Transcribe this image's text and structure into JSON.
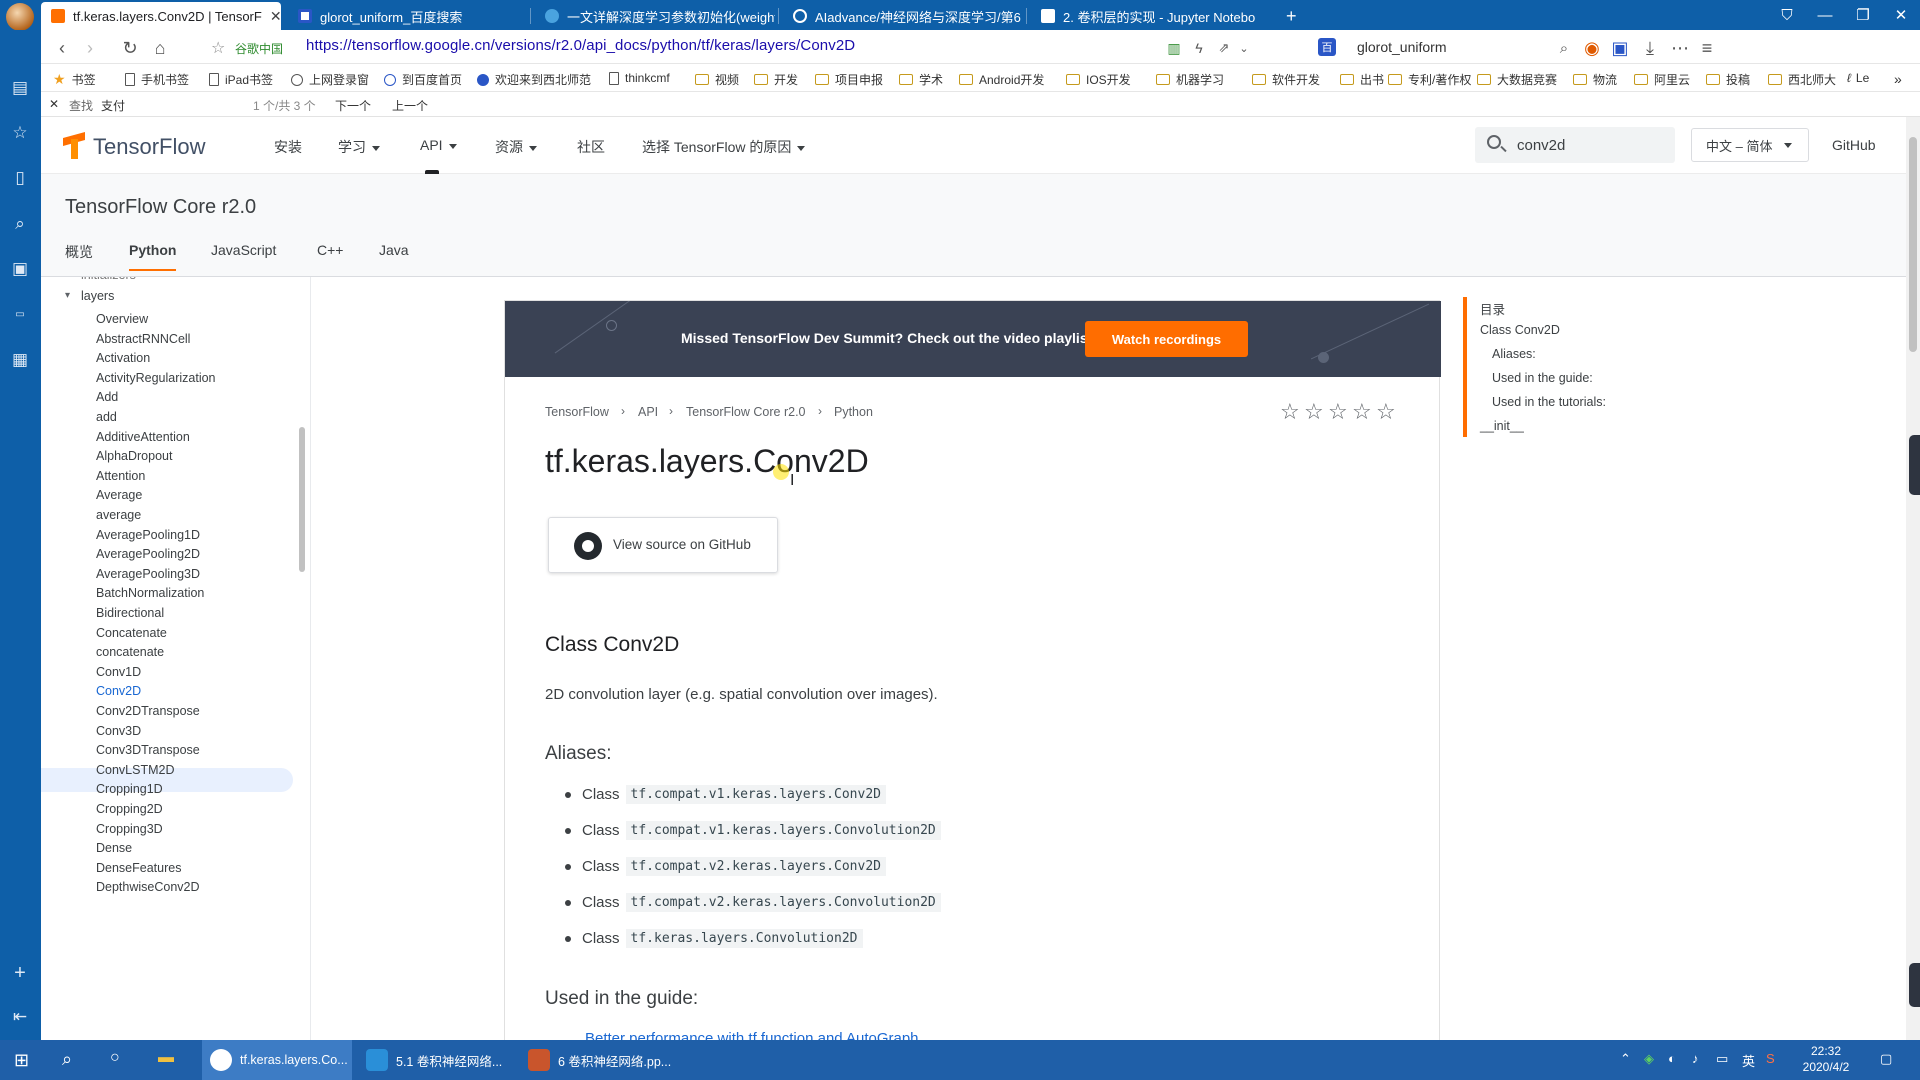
{
  "browser": {
    "tabs": [
      {
        "title": "tf.keras.layers.Conv2D  |  TensorF",
        "active": true
      },
      {
        "title": "glorot_uniform_百度搜索"
      },
      {
        "title": "一文详解深度学习参数初始化(weight"
      },
      {
        "title": "AIadvance/神经网络与深度学习/第6"
      },
      {
        "title": "2. 卷积层的实现 - Jupyter Notebo"
      }
    ],
    "new_tab": "+",
    "url_site": "谷歌中国",
    "url": "https://tensorflow.google.cn/versions/r2.0/api_docs/python/tf/keras/layers/Conv2D",
    "search_engine_value": "glorot_uniform"
  },
  "bookmarks": [
    "书签",
    "手机书签",
    "iPad书签",
    "上网登录窗",
    "到百度首页",
    "欢迎来到西北师范",
    "thinkcmf",
    "视频",
    "开发",
    "项目申报",
    "学术",
    "Android开发",
    "IOS开发",
    "机器学习",
    "软件开发",
    "出书",
    "专利/著作权",
    "大数据竞赛",
    "物流",
    "阿里云",
    "投稿",
    "西北师大",
    "Le"
  ],
  "findbar": {
    "close": "✕",
    "label": "查找",
    "value": "支付",
    "count": "1 个/共 3 个",
    "next": "下一个",
    "prev": "上一个"
  },
  "tf": {
    "logo_text": "TensorFlow",
    "nav": [
      {
        "label": "安装",
        "dropdown": false
      },
      {
        "label": "学习",
        "dropdown": true
      },
      {
        "label": "API",
        "dropdown": true
      },
      {
        "label": "资源",
        "dropdown": true
      },
      {
        "label": "社区",
        "dropdown": false
      },
      {
        "label": "选择 TensorFlow 的原因",
        "dropdown": true
      }
    ],
    "search_value": "conv2d",
    "language": "中文 – 简体",
    "github": "GitHub",
    "subtitle": "TensorFlow Core r2.0",
    "subtabs": [
      "概览",
      "Python",
      "JavaScript",
      "C++",
      "Java"
    ],
    "active_subtab": "Python"
  },
  "leftnav": {
    "partial_top": "initializers",
    "section": "layers",
    "items": [
      "Overview",
      "AbstractRNNCell",
      "Activation",
      "ActivityRegularization",
      "Add",
      "add",
      "AdditiveAttention",
      "AlphaDropout",
      "Attention",
      "Average",
      "average",
      "AveragePooling1D",
      "AveragePooling2D",
      "AveragePooling3D",
      "BatchNormalization",
      "Bidirectional",
      "Concatenate",
      "concatenate",
      "Conv1D",
      "Conv2D",
      "Conv2DTranspose",
      "Conv3D",
      "Conv3DTranspose",
      "ConvLSTM2D",
      "Cropping1D",
      "Cropping2D",
      "Cropping3D",
      "Dense",
      "DenseFeatures",
      "DepthwiseConv2D"
    ],
    "active_item": "Conv2D"
  },
  "article": {
    "banner_text": "Missed TensorFlow Dev Summit? Check out the video playlist.",
    "banner_button": "Watch recordings",
    "breadcrumbs": [
      "TensorFlow",
      "API",
      "TensorFlow Core r2.0",
      "Python"
    ],
    "rating_stars": 5,
    "title": "tf.keras.layers.Conv2D",
    "view_source": "View source on GitHub",
    "class_heading_prefix": "Class ",
    "class_heading_code": "Conv2D",
    "class_description": "2D convolution layer (e.g. spatial convolution over images).",
    "aliases_heading": "Aliases:",
    "aliases": [
      {
        "prefix": "Class",
        "code": "tf.compat.v1.keras.layers.Conv2D"
      },
      {
        "prefix": "Class",
        "code": "tf.compat.v1.keras.layers.Convolution2D"
      },
      {
        "prefix": "Class",
        "code": "tf.compat.v2.keras.layers.Conv2D"
      },
      {
        "prefix": "Class",
        "code": "tf.compat.v2.keras.layers.Convolution2D"
      },
      {
        "prefix": "Class",
        "code": "tf.keras.layers.Convolution2D"
      }
    ],
    "guide_heading": "Used in the guide:",
    "guide_link": "Better performance with tf.function and AutoGraph"
  },
  "toc": {
    "title": "目录",
    "items": [
      {
        "label": "Class Conv2D",
        "level": 0
      },
      {
        "label": "Aliases:",
        "level": 1
      },
      {
        "label": "Used in the guide:",
        "level": 1
      },
      {
        "label": "Used in the tutorials:",
        "level": 1
      },
      {
        "label": "__init__",
        "level": 0
      }
    ]
  },
  "taskbar": {
    "items": [
      {
        "label": "tf.keras.layers.Co...",
        "active": true
      },
      {
        "label": "5.1 卷积神经网络..."
      },
      {
        "label": "6 卷积神经网络.pp..."
      }
    ],
    "ime": "英",
    "time": "22:32",
    "date": "2020/4/2"
  },
  "colors": {
    "browser_blue": "#0e5fa8",
    "tf_orange": "#ff6d00",
    "link_blue": "#1967d2",
    "banner_bg": "#3a4254"
  }
}
